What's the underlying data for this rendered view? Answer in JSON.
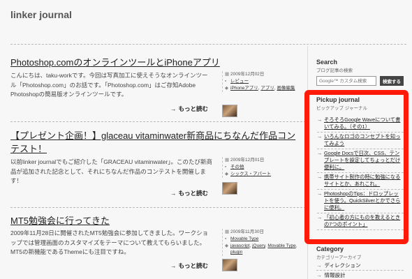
{
  "site": {
    "title": "linker journal"
  },
  "posts": [
    {
      "title": "Photoshop.comのオンラインツールとiPhoneアプリ",
      "excerpt": "こんにちは、taku-workです。今回は写真加工に使えそうなオンラインツール「Photoshop.com」のお話です。「Photoshop.com」はご存知Adobe Photoshopの簡易版オンラインツールです。",
      "date": "2009年12月02日",
      "category": "レビュー",
      "tags": [
        "iPhoneアプリ",
        "アプリ",
        "画像編集"
      ],
      "more": "もっと読む"
    },
    {
      "title": "【プレゼント企画！】glaceau vitaminwater新商品にちなんだ作品コンテスト！",
      "excerpt": "以前linker journalでもご紹介した「GRACEAU vitaminwater」。このたび新商品が追加された記念として、それにちなんだ作品のコンテストを開催します！",
      "date": "2009年12月01日",
      "category": "その他",
      "tags": [
        "シックス・アパート"
      ],
      "more": "もっと読む"
    },
    {
      "title": "MT5勉強会に行ってきた",
      "excerpt": "2009年11月28日に開催されたMT5勉強会に参加してきました。ワークショップでは管理画面のカスタマイズをテーマについて教えてもらいました。MT5の新機能であるThemeにも注目ですね。",
      "date": "2009年11月30日",
      "category": "Movable Type",
      "tags": [
        "javascript",
        "jQuery",
        "Movable Type",
        "plugin"
      ],
      "more": "もっと読む"
    }
  ],
  "sidebar": {
    "search": {
      "heading": "Search",
      "sub": "ブログ記事の検索",
      "placeholder": "Google™ カスタム検索",
      "button": "検索する"
    },
    "pickup": {
      "heading": "Pickup journal",
      "sub": "ピックアップ ジャーナル",
      "items": [
        "そろそろGoogle Waveについて書いてみる。（その1）",
        "いろんなロゴのコンセプトを知ってみよう",
        "Google Docsで日次、CSS、テンプレートを設定してちょっとだけ便利に。",
        "携帯サイト制作の時に勉強になるサイトとか、あれこれ。",
        "PhotoshopのTips：ドロップレットを使う。QuickSilverとかでさらに便利。",
        "「初心者の方にものを教えるときの7つのポイント」"
      ]
    },
    "category": {
      "heading": "Category",
      "sub": "カテゴリーアーカイブ",
      "items": [
        "ディレクション",
        "情報設計"
      ]
    }
  },
  "icons": {
    "arrow": "→",
    "date": "calendar-icon",
    "folder": "folder-icon",
    "tag": "tag-icon"
  },
  "colors": {
    "highlight": "#ff1a0a",
    "background": "#f7f7f7",
    "button": "#444444"
  }
}
